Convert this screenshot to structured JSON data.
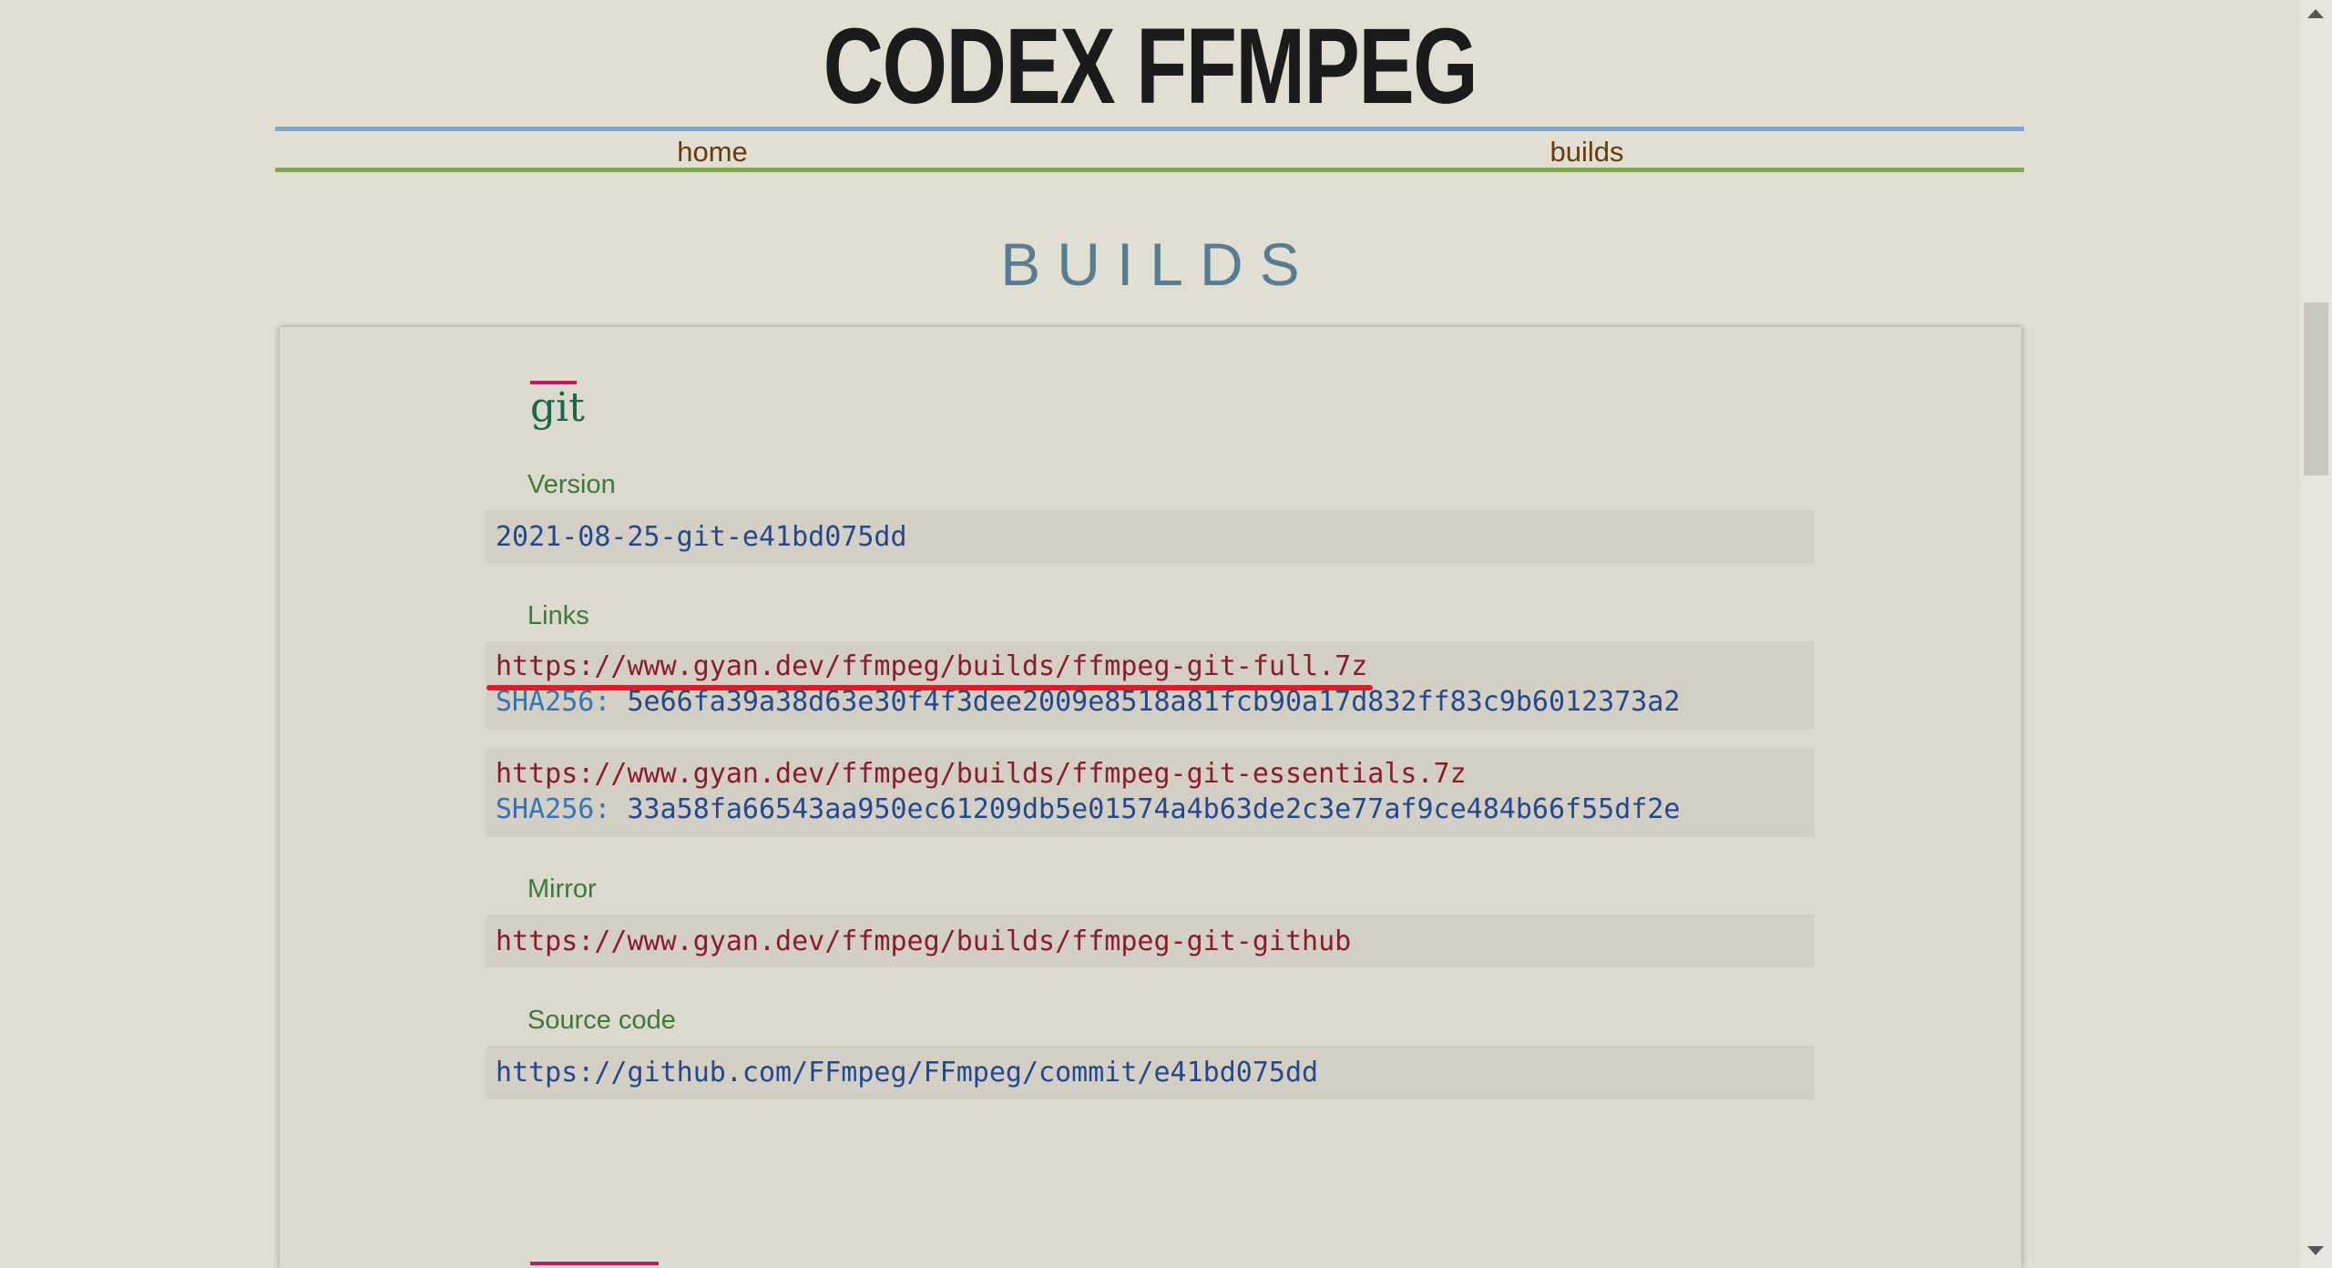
{
  "site": {
    "title": "CODEX FFMPEG"
  },
  "nav": {
    "items": [
      {
        "label": "home"
      },
      {
        "label": "builds"
      }
    ]
  },
  "page": {
    "heading": "BUILDS"
  },
  "section": {
    "title": "git",
    "version_label": "Version",
    "version_value": "2021-08-25-git-e41bd075dd",
    "links_label": "Links",
    "links": [
      {
        "url": "https://www.gyan.dev/ffmpeg/builds/ffmpeg-git-full.7z",
        "sha_label": "SHA256:",
        "sha_value": "5e66fa39a38d63e30f4f3dee2009e8518a81fcb90a17d832ff83c9b6012373a2"
      },
      {
        "url": "https://www.gyan.dev/ffmpeg/builds/ffmpeg-git-essentials.7z",
        "sha_label": "SHA256:",
        "sha_value": "33a58fa66543aa950ec61209db5e01574a4b63de2c3e77af9ce484b66f55df2e"
      }
    ],
    "mirror_label": "Mirror",
    "mirror_url": "https://www.gyan.dev/ffmpeg/builds/ffmpeg-git-github",
    "source_label": "Source code",
    "source_url": "https://github.com/FFmpeg/FFmpeg/commit/e41bd075dd"
  },
  "colors": {
    "background": "#e1dfd2",
    "accent": "#c8155a",
    "nav_top_border": "#7aa6d9",
    "nav_bottom_border": "#7fa54f",
    "annotation": "#e2182b"
  },
  "icons": {
    "scroll_up": "chevron-up-icon",
    "scroll_down": "chevron-down-icon"
  }
}
